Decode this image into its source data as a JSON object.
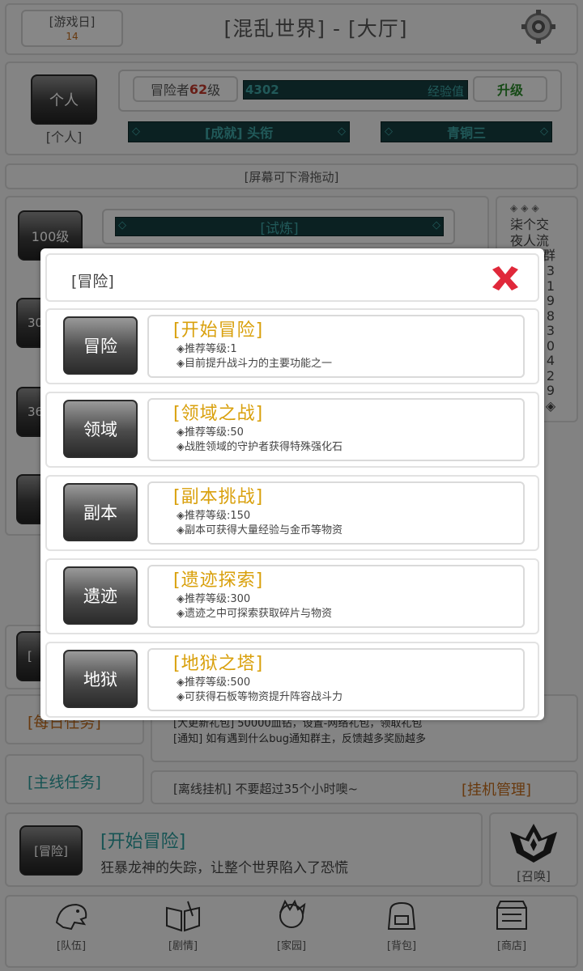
{
  "header": {
    "day_label": "[游戏日]",
    "day_value": "14",
    "title": "[混乱世界] - [大厅]"
  },
  "profile": {
    "avatar_label": "个人",
    "avatar_caption": "[个人]",
    "level_prefix": "冒险者",
    "level_value": "62",
    "level_suffix": "级",
    "exp_value": "4302",
    "exp_label": "经验值",
    "upgrade_label": "升级",
    "achievement_label": "[成就] 头衔",
    "rank_label": "青铜三"
  },
  "scroll_hint": "[屏幕可下滑拖动]",
  "sidebar": {
    "level_100": "100级",
    "level_30": "30",
    "level_36": "36",
    "trial_label": "[试炼]",
    "glyphs": "◈◈◈",
    "lines": [
      "柒个交",
      "夜人流",
      "群"
    ],
    "digits": [
      "3",
      "1",
      "9",
      "8",
      "3",
      "0",
      "4",
      "2",
      "9",
      "◈"
    ]
  },
  "background": {
    "left_bracket": "[",
    "news": [
      "[大更新礼包] 50000血钻，设置-网络礼包，领取礼包",
      "[通知] 如有遇到什么bug通知群主，反馈越多奖励越多"
    ],
    "daily_task": "[每日任务]",
    "main_task": "[主线任务]",
    "offline_text": "[离线挂机] 不要超过35个小时噢~",
    "idle_manage": "[挂机管理]",
    "adventure_btn": "[冒险]",
    "adventure_title": "[开始冒险]",
    "adventure_desc": "狂暴龙神的失踪，让整个世界陷入了恐慌",
    "summon_label": "[召唤]"
  },
  "nav": [
    {
      "label": "[队伍]",
      "icon": "dino-icon"
    },
    {
      "label": "[剧情]",
      "icon": "book-icon"
    },
    {
      "label": "[家园]",
      "icon": "hero-head-icon"
    },
    {
      "label": "[背包]",
      "icon": "backpack-icon"
    },
    {
      "label": "[商店]",
      "icon": "shop-icon"
    }
  ],
  "modal": {
    "title": "[冒险]",
    "rows": [
      {
        "button": "冒险",
        "title": "[开始冒险]",
        "level": "◈推荐等级:1",
        "desc": "◈目前提升战斗力的主要功能之一"
      },
      {
        "button": "领域",
        "title": "[领域之战]",
        "level": "◈推荐等级:50",
        "desc": "◈战胜领域的守护者获得特殊强化石"
      },
      {
        "button": "副本",
        "title": "[副本挑战]",
        "level": "◈推荐等级:150",
        "desc": "◈副本可获得大量经验与金币等物资"
      },
      {
        "button": "遗迹",
        "title": "[遗迹探索]",
        "level": "◈推荐等级:300",
        "desc": "◈遗迹之中可探索获取碎片与物资"
      },
      {
        "button": "地狱",
        "title": "[地狱之塔]",
        "level": "◈推荐等级:500",
        "desc": "◈可获得石板等物资提升阵容战斗力"
      }
    ]
  },
  "colors": {
    "accent_gold": "#d9a00c",
    "bar_teal_bg": "#163e3f",
    "bar_teal_text": "#3da5a5",
    "close_red": "#e0283a",
    "level_red": "#c0392b"
  }
}
